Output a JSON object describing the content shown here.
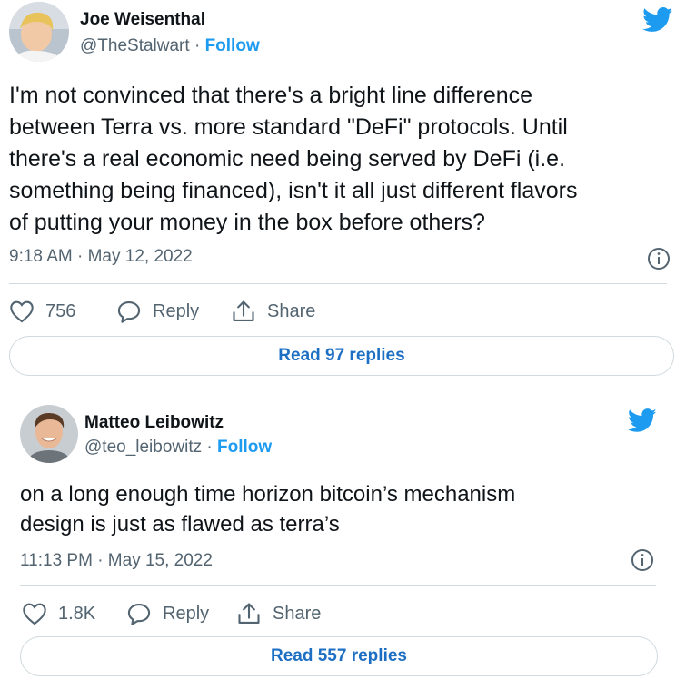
{
  "tweets": [
    {
      "author_name": "Joe Weisenthal",
      "handle": "@TheStalwart",
      "separator": "·",
      "follow_label": "Follow",
      "text": "I'm not convinced that there's a bright line difference\nbetween Terra vs. more standard \"DeFi\" protocols. Until\nthere's a real economic need being served by DeFi (i.e.\nsomething being financed), isn't it all just different flavors\nof putting your money in the box before others?",
      "timestamp": "9:18 AM · May 12, 2022",
      "like_count": "756",
      "reply_label": "Reply",
      "share_label": "Share",
      "read_replies_label": "Read 97 replies",
      "brand_icon": "twitter-bird-icon"
    },
    {
      "author_name": "Matteo Leibowitz",
      "handle": "@teo_leibowitz",
      "separator": "·",
      "follow_label": "Follow",
      "text": "on a long enough time horizon bitcoin’s mechanism\ndesign is just as flawed as terra’s",
      "timestamp": "11:13 PM · May 15, 2022",
      "like_count": "1.8K",
      "reply_label": "Reply",
      "share_label": "Share",
      "read_replies_label": "Read 557 replies",
      "brand_icon": "twitter-bird-icon"
    }
  ],
  "colors": {
    "brand_blue": "#1d9bf0",
    "text": "#0f1419",
    "secondary": "#536471",
    "border": "#cfd9de"
  }
}
